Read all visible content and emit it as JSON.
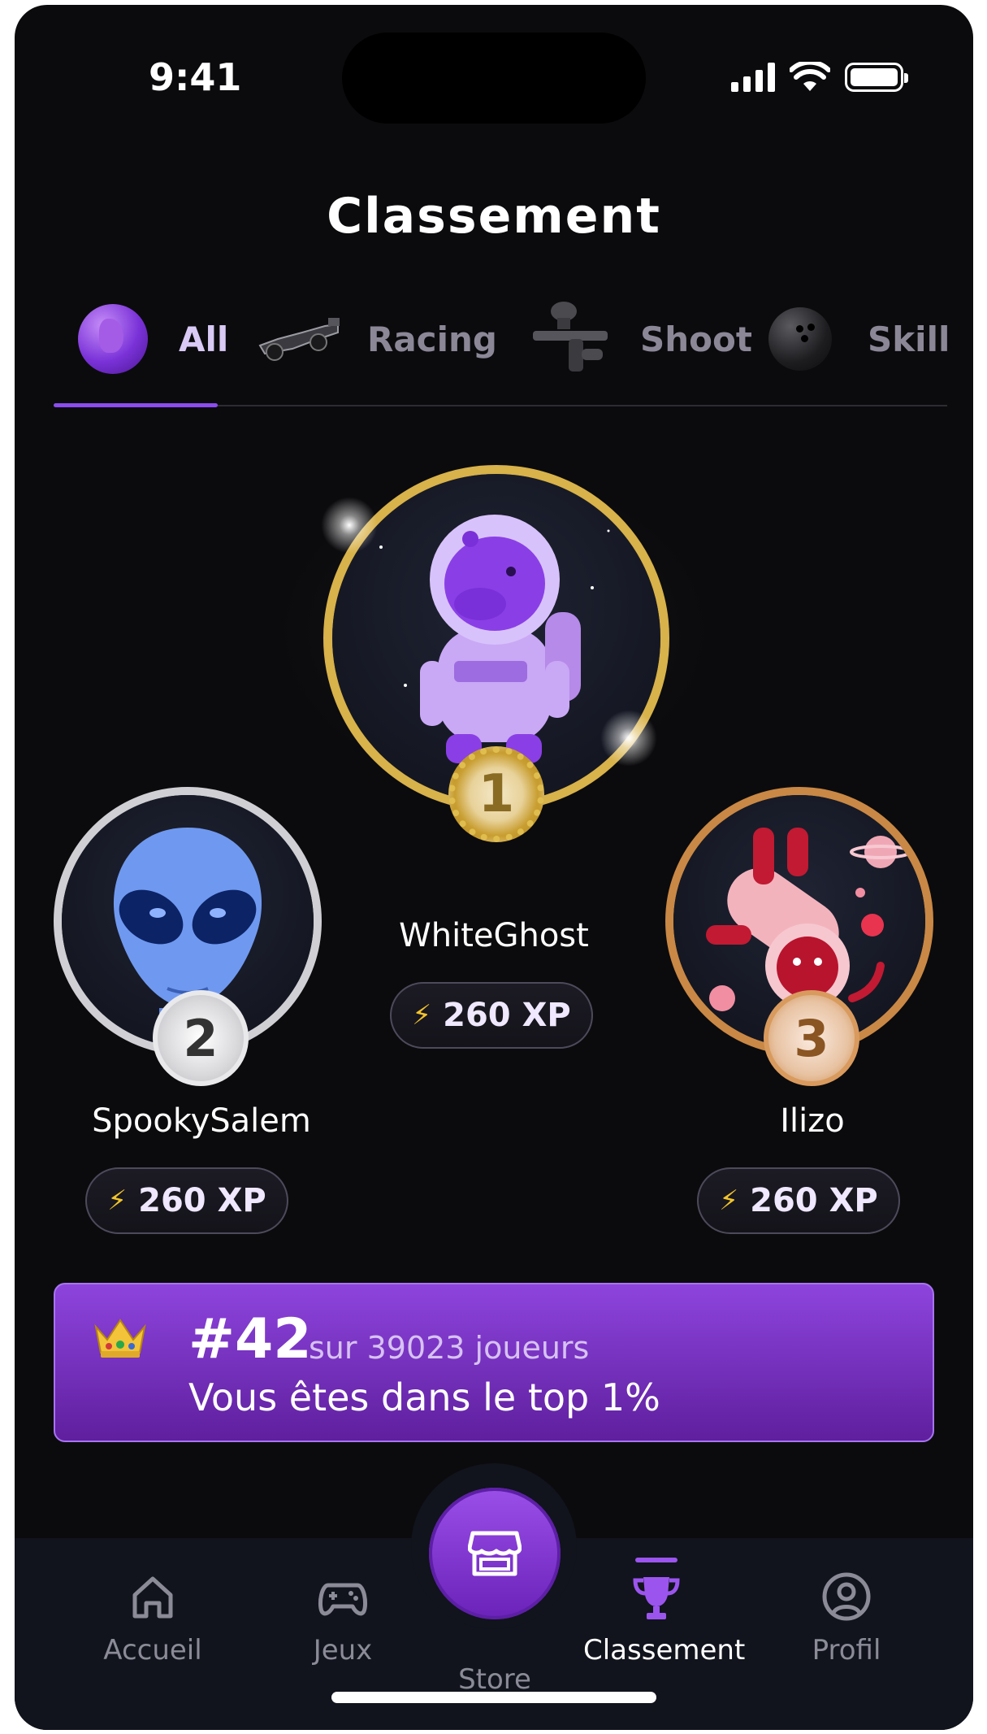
{
  "status_bar": {
    "time": "9:41"
  },
  "page": {
    "title": "Classement"
  },
  "tabs": [
    {
      "label": "All",
      "icon": "globe-icon",
      "active": true
    },
    {
      "label": "Racing",
      "icon": "race-car-icon",
      "active": false
    },
    {
      "label": "Shoot",
      "icon": "paintball-gun-icon",
      "active": false
    },
    {
      "label": "Skill",
      "icon": "bowling-ball-icon",
      "active": false
    }
  ],
  "podium": {
    "first": {
      "rank": "1",
      "name": "WhiteGhost",
      "xp": "260 XP",
      "avatar": "capybara-astronaut"
    },
    "second": {
      "rank": "2",
      "name": "SpookySalem",
      "xp": "260 XP",
      "avatar": "alien"
    },
    "third": {
      "rank": "3",
      "name": "Ilizo",
      "xp": "260 XP",
      "avatar": "cat-astronaut"
    }
  },
  "rank_banner": {
    "rank": "#42",
    "total": "sur 39023 joueurs",
    "message": "Vous êtes dans le top 1%",
    "icon": "crown-icon"
  },
  "nav": {
    "items": [
      {
        "label": "Accueil",
        "icon": "home-icon"
      },
      {
        "label": "Jeux",
        "icon": "gamepad-icon"
      },
      {
        "label": "Store",
        "icon": "store-icon"
      },
      {
        "label": "Classement",
        "icon": "trophy-icon",
        "active": true
      },
      {
        "label": "Profil",
        "icon": "profile-icon"
      }
    ]
  },
  "colors": {
    "accent": "#8b4cf0",
    "gold": "#d8b24a",
    "silver": "#cfcfd4",
    "bronze": "#c98845",
    "background": "#0b0b0d"
  }
}
